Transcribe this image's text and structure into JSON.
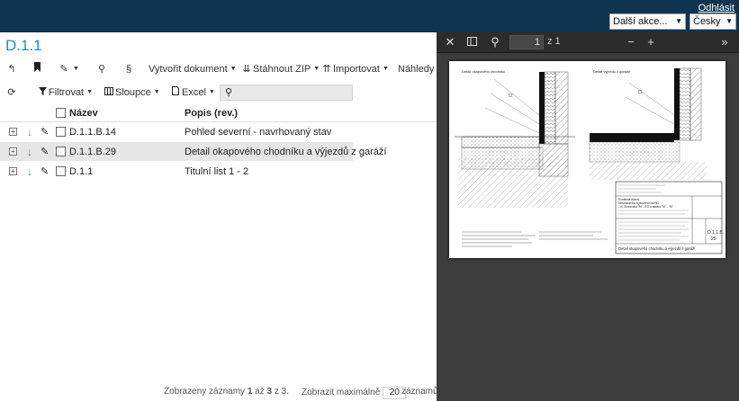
{
  "header": {
    "logout": "Odhlásit",
    "actions_select": "Další akce...",
    "language_select": "Česky"
  },
  "page_title": "D.1.1",
  "toolbar1": {
    "create_document": "Vytvořit dokument",
    "download_zip": "Stáhnout ZIP",
    "import": "Importovat",
    "previews": "Náhledy"
  },
  "toolbar2": {
    "filter": "Filtrovat",
    "columns": "Sloupce",
    "excel": "Excel",
    "search_value": ""
  },
  "table": {
    "col_name": "Název",
    "col_desc": "Popis (rev.)",
    "rows": [
      {
        "name": "D.1.1.B.14",
        "desc": "Pohled severní - navrhovaný stav",
        "selected": false
      },
      {
        "name": "D.1.1.B.29",
        "desc": "Detail okapového chodníku a výjezdů z garáží",
        "selected": true
      },
      {
        "name": "D.1.1",
        "desc": "Titulní list 1 - 2",
        "selected": false
      }
    ]
  },
  "footer": {
    "shown_prefix": "Zobrazeny záznamy",
    "shown_from": "1",
    "shown_to_word": "až",
    "shown_to": "3",
    "shown_of_word": "z",
    "shown_total": "3.",
    "max_label": "Zobrazit maximálně",
    "max_value": "20",
    "max_suffix": "záznamů."
  },
  "viewer": {
    "page_number": "1",
    "page_of": "z 1",
    "drawing": {
      "left_title": "Detail okapového chodníku",
      "right_title": "Detail výjezdu z garáže",
      "tb_line1": "Rodinné domy",
      "tb_line2": "Novostavba bytového domu",
      "tb_line3": "- ul. Slovanská \"M\" - EO a stavba \"M\" - \"M\"",
      "tb_code": "D.1.1.B.",
      "tb_num": "29",
      "tb_caption": "Detail okapového chodníku a výjezdů z garáží"
    }
  },
  "colors": {
    "header_bg": "#0e3450",
    "title_blue": "#1b8fd4",
    "viewer_bg": "#3d3d3d",
    "viewer_toolbar": "#2c2c2c",
    "arrow_green": "#2aa84a",
    "selected_row": "#e6e6e6"
  }
}
